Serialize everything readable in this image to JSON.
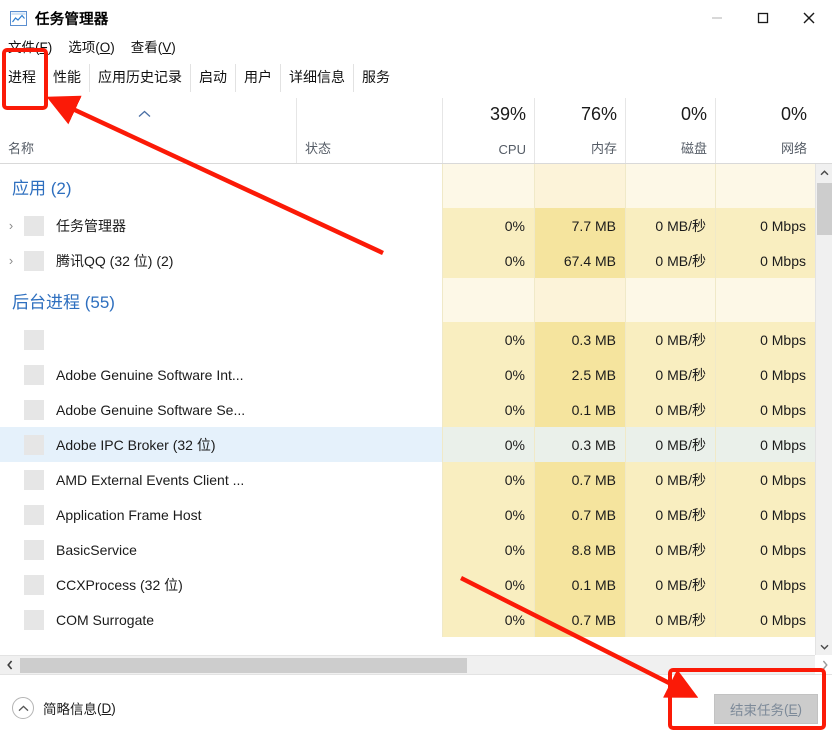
{
  "window": {
    "title": "任务管理器",
    "icon": "task-manager-icon",
    "minimize": "—",
    "maximize": "▢",
    "close": "✕"
  },
  "menu": [
    {
      "label": "文件",
      "mnemonic": "F"
    },
    {
      "label": "选项",
      "mnemonic": "O"
    },
    {
      "label": "查看",
      "mnemonic": "V"
    }
  ],
  "tabs": [
    {
      "label": "进程",
      "active": true
    },
    {
      "label": "性能",
      "active": false
    },
    {
      "label": "应用历史记录",
      "active": false
    },
    {
      "label": "启动",
      "active": false
    },
    {
      "label": "用户",
      "active": false
    },
    {
      "label": "详细信息",
      "active": false
    },
    {
      "label": "服务",
      "active": false
    }
  ],
  "columns": {
    "name": "名称",
    "sort_caret": "︿",
    "status": "状态",
    "cpu": {
      "pct": "39%",
      "label": "CPU"
    },
    "memory": {
      "pct": "76%",
      "label": "内存"
    },
    "disk": {
      "pct": "0%",
      "label": "磁盘"
    },
    "network": {
      "pct": "0%",
      "label": "网络"
    }
  },
  "groups": [
    {
      "title": "应用 (2)"
    },
    {
      "title": "后台进程 (55)"
    }
  ],
  "rows": [
    {
      "kind": "group",
      "title": "应用 (2)",
      "cpu": "",
      "memory": "",
      "disk": "",
      "network": ""
    },
    {
      "kind": "app",
      "expandable": true,
      "name": "任务管理器",
      "cpu": "0%",
      "memory": "7.7 MB",
      "disk": "0 MB/秒",
      "network": "0 Mbps",
      "selected": false
    },
    {
      "kind": "app",
      "expandable": true,
      "name": "腾讯QQ (32 位) (2)",
      "cpu": "0%",
      "memory": "67.4 MB",
      "disk": "0 MB/秒",
      "network": "0 Mbps",
      "selected": false
    },
    {
      "kind": "group",
      "title": "后台进程 (55)",
      "cpu": "",
      "memory": "",
      "disk": "",
      "network": ""
    },
    {
      "kind": "proc",
      "expandable": false,
      "name": "",
      "cpu": "0%",
      "memory": "0.3 MB",
      "disk": "0 MB/秒",
      "network": "0 Mbps",
      "selected": false
    },
    {
      "kind": "proc",
      "expandable": false,
      "name": "Adobe Genuine Software Int...",
      "cpu": "0%",
      "memory": "2.5 MB",
      "disk": "0 MB/秒",
      "network": "0 Mbps",
      "selected": false
    },
    {
      "kind": "proc",
      "expandable": false,
      "name": "Adobe Genuine Software Se...",
      "cpu": "0%",
      "memory": "0.1 MB",
      "disk": "0 MB/秒",
      "network": "0 Mbps",
      "selected": false
    },
    {
      "kind": "proc",
      "expandable": false,
      "name": "Adobe IPC Broker (32 位)",
      "cpu": "0%",
      "memory": "0.3 MB",
      "disk": "0 MB/秒",
      "network": "0 Mbps",
      "selected": true
    },
    {
      "kind": "proc",
      "expandable": false,
      "name": "AMD External Events Client ...",
      "cpu": "0%",
      "memory": "0.7 MB",
      "disk": "0 MB/秒",
      "network": "0 Mbps",
      "selected": false
    },
    {
      "kind": "proc",
      "expandable": false,
      "name": "Application Frame Host",
      "cpu": "0%",
      "memory": "0.7 MB",
      "disk": "0 MB/秒",
      "network": "0 Mbps",
      "selected": false
    },
    {
      "kind": "proc",
      "expandable": false,
      "name": "BasicService",
      "cpu": "0%",
      "memory": "8.8 MB",
      "disk": "0 MB/秒",
      "network": "0 Mbps",
      "selected": false
    },
    {
      "kind": "proc",
      "expandable": false,
      "name": "CCXProcess (32 位)",
      "cpu": "0%",
      "memory": "0.1 MB",
      "disk": "0 MB/秒",
      "network": "0 Mbps",
      "selected": false
    },
    {
      "kind": "proc",
      "expandable": false,
      "name": "COM Surrogate",
      "cpu": "0%",
      "memory": "0.7 MB",
      "disk": "0 MB/秒",
      "network": "0 Mbps",
      "selected": false
    }
  ],
  "footer": {
    "fewer_details": "简略信息",
    "fewer_mnemonic": "D",
    "end_task": "结束任务",
    "end_task_mnemonic": "E",
    "end_task_disabled": true
  },
  "scrollbars": {
    "vertical_up": "︿",
    "vertical_down": "﹀",
    "horizontal_left": "‹",
    "horizontal_right": "›"
  },
  "annotations": {
    "color": "#fb1a07",
    "highlight_boxes": [
      "processes-tab",
      "end-task-button"
    ],
    "arrows": 2
  }
}
